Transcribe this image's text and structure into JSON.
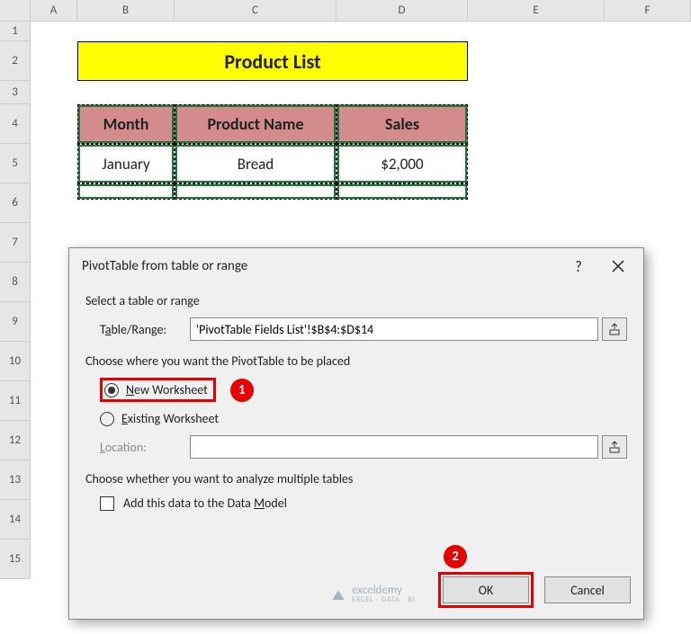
{
  "columns": {
    "A": "A",
    "B": "B",
    "C": "C",
    "D": "D",
    "E": "E",
    "F": "F"
  },
  "rows": [
    "1",
    "2",
    "3",
    "4",
    "5",
    "6",
    "7",
    "8",
    "9",
    "10",
    "11",
    "12",
    "13",
    "14",
    "15"
  ],
  "sheet": {
    "title": "Product List",
    "headers": {
      "month": "Month",
      "product": "Product Name",
      "sales": "Sales"
    },
    "data": [
      {
        "month": "January",
        "product": "Bread",
        "sales": "$2,000"
      }
    ]
  },
  "dialog": {
    "title": "PivotTable from table or range",
    "section1": "Select a table or range",
    "table_range_label_pre": "T",
    "table_range_label_u": "a",
    "table_range_label_post": "ble/Range:",
    "table_range_value": "'PivotTable Fields List'!$B$4:$D$14",
    "section2": "Choose where you want the PivotTable to be placed",
    "opt_new_pre": "",
    "opt_new_u": "N",
    "opt_new_post": "ew Worksheet",
    "opt_existing_pre": "",
    "opt_existing_u": "E",
    "opt_existing_post": "xisting Worksheet",
    "location_label_pre": "",
    "location_label_u": "L",
    "location_label_post": "ocation:",
    "section3": "Choose whether you want to analyze multiple tables",
    "add_model_pre": "Add this data to the Data ",
    "add_model_u": "M",
    "add_model_post": "odel",
    "ok": "OK",
    "cancel": "Cancel",
    "callout1": "1",
    "callout2": "2"
  },
  "watermark": {
    "brand": "exceldemy",
    "sub": "EXCEL · DATA · BI"
  }
}
